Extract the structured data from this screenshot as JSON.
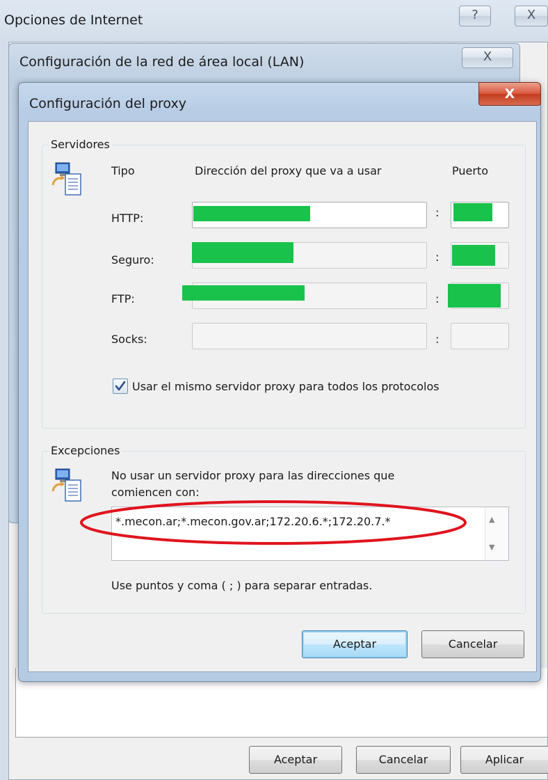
{
  "window_internet_options": {
    "title": "Opciones de Internet",
    "help_icon": "?",
    "close_icon": "X",
    "buttons": {
      "ok": "Aceptar",
      "cancel": "Cancelar",
      "apply": "Aplicar"
    }
  },
  "window_lan": {
    "title": "Configuración de la red de área local (LAN)",
    "close_icon": "X"
  },
  "window_proxy": {
    "title": "Configuración del proxy",
    "close_icon": "X",
    "servers": {
      "group_label": "Servidores",
      "icon": "network-computer-icon",
      "headers": {
        "type": "Tipo",
        "address": "Dirección del proxy que va a usar",
        "port": "Puerto"
      },
      "rows": [
        {
          "label": "HTTP:",
          "address": "",
          "port": "",
          "redacted": true
        },
        {
          "label": "Seguro:",
          "address": "",
          "port": "",
          "redacted": true
        },
        {
          "label": "FTP:",
          "address": "",
          "port": "",
          "redacted": true
        },
        {
          "label": "Socks:",
          "address": "",
          "port": "",
          "redacted": false
        }
      ],
      "colon": ":",
      "same_proxy_checkbox": {
        "label": "Usar el mismo servidor proxy para todos los protocolos",
        "checked": true
      }
    },
    "exceptions": {
      "group_label": "Excepciones",
      "icon": "network-computer-icon",
      "description_line1": "No usar un servidor proxy para las direcciones que",
      "description_line2": "comiencen con:",
      "value": "*.mecon.ar;*.mecon.gov.ar;172.20.6.*;172.20.7.*",
      "hint": "Use puntos y coma ( ; ) para separar entradas."
    },
    "buttons": {
      "ok": "Aceptar",
      "cancel": "Cancelar"
    }
  },
  "colors": {
    "redaction": "#19c34b",
    "annotation_ellipse": "#e0141e",
    "close_button": "#c94a2e"
  }
}
